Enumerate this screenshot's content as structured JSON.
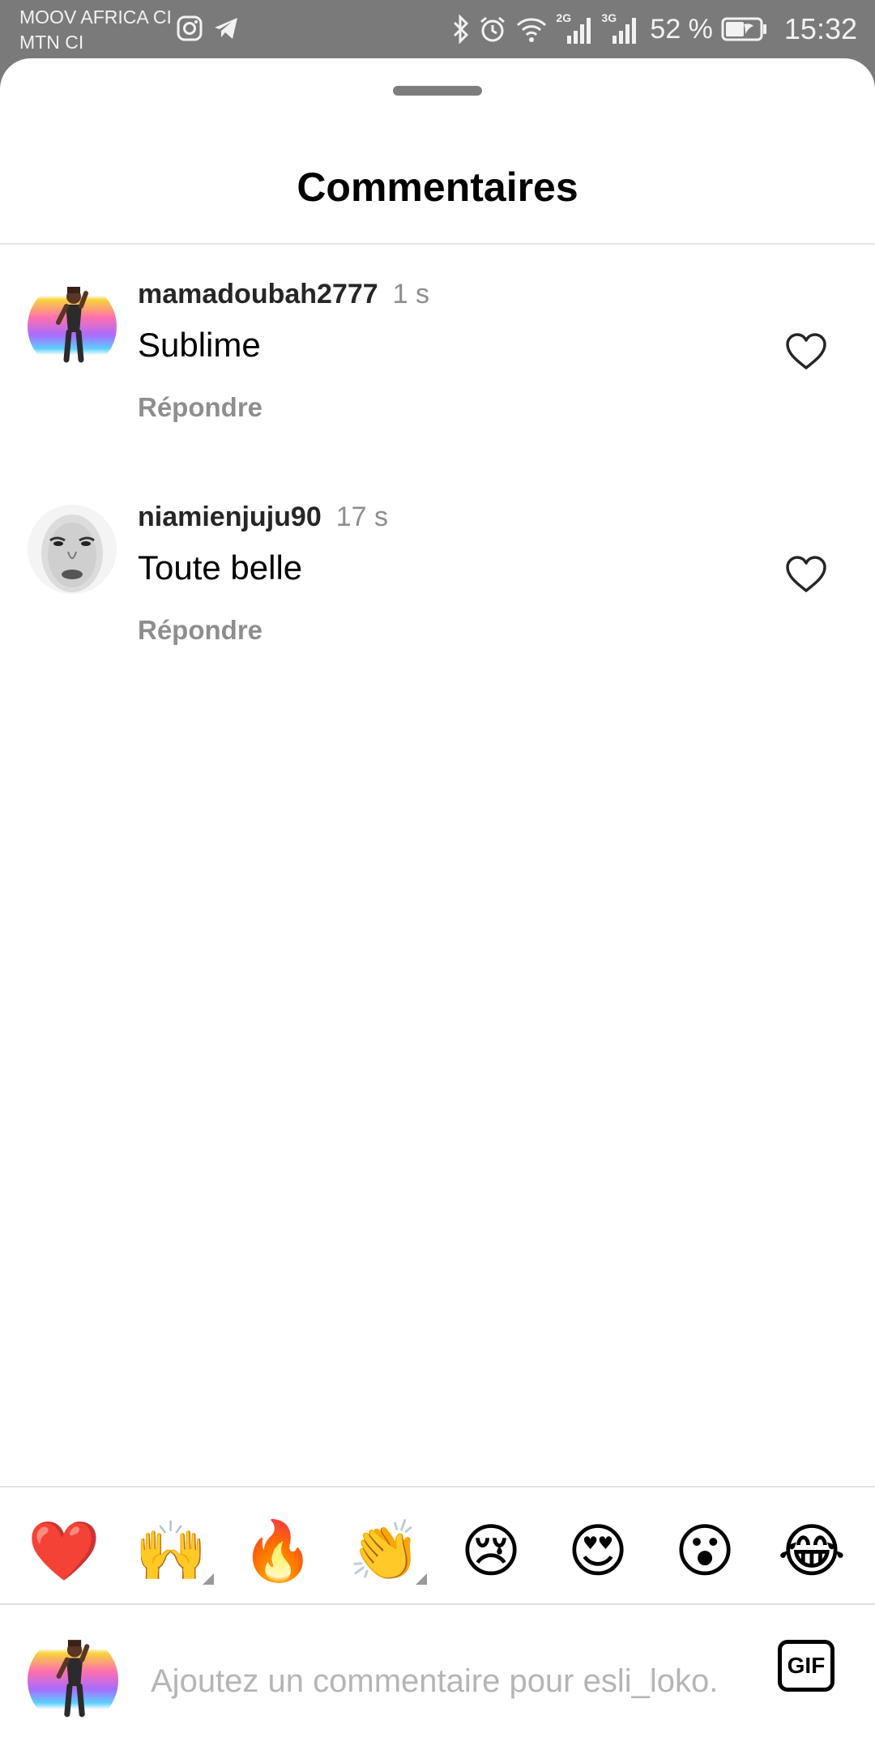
{
  "status_bar": {
    "carrier_1": "MOOV AFRICA CI",
    "carrier_2": "MTN CI",
    "network_1": "2G",
    "network_2": "3G",
    "battery": "52 %",
    "time": "15:32",
    "icons": [
      "instagram-icon",
      "telegram-icon",
      "bluetooth-icon",
      "alarm-icon",
      "wifi-icon",
      "signal-icon",
      "battery-icon"
    ]
  },
  "sheet": {
    "title": "Commentaires"
  },
  "comments": [
    {
      "username": "mamadoubah2777",
      "time": "1 s",
      "text": "Sublime",
      "reply_label": "Répondre",
      "avatar": "avatar-figure-rainbow"
    },
    {
      "username": "niamienjuju90",
      "time": "17 s",
      "text": "Toute belle",
      "reply_label": "Répondre",
      "avatar": "avatar-face-sketch"
    }
  ],
  "emoji_bar": [
    "❤️",
    "🙌",
    "🔥",
    "👏",
    "😢",
    "😍",
    "😮",
    "😂"
  ],
  "composer": {
    "placeholder": "Ajoutez un commentaire pour esli_loko.",
    "gif_label": "GIF"
  },
  "colors": {
    "status_bar_bg": "#7a7a7a",
    "secondary_text": "#8e8e8e",
    "placeholder": "#b5b5b5"
  }
}
